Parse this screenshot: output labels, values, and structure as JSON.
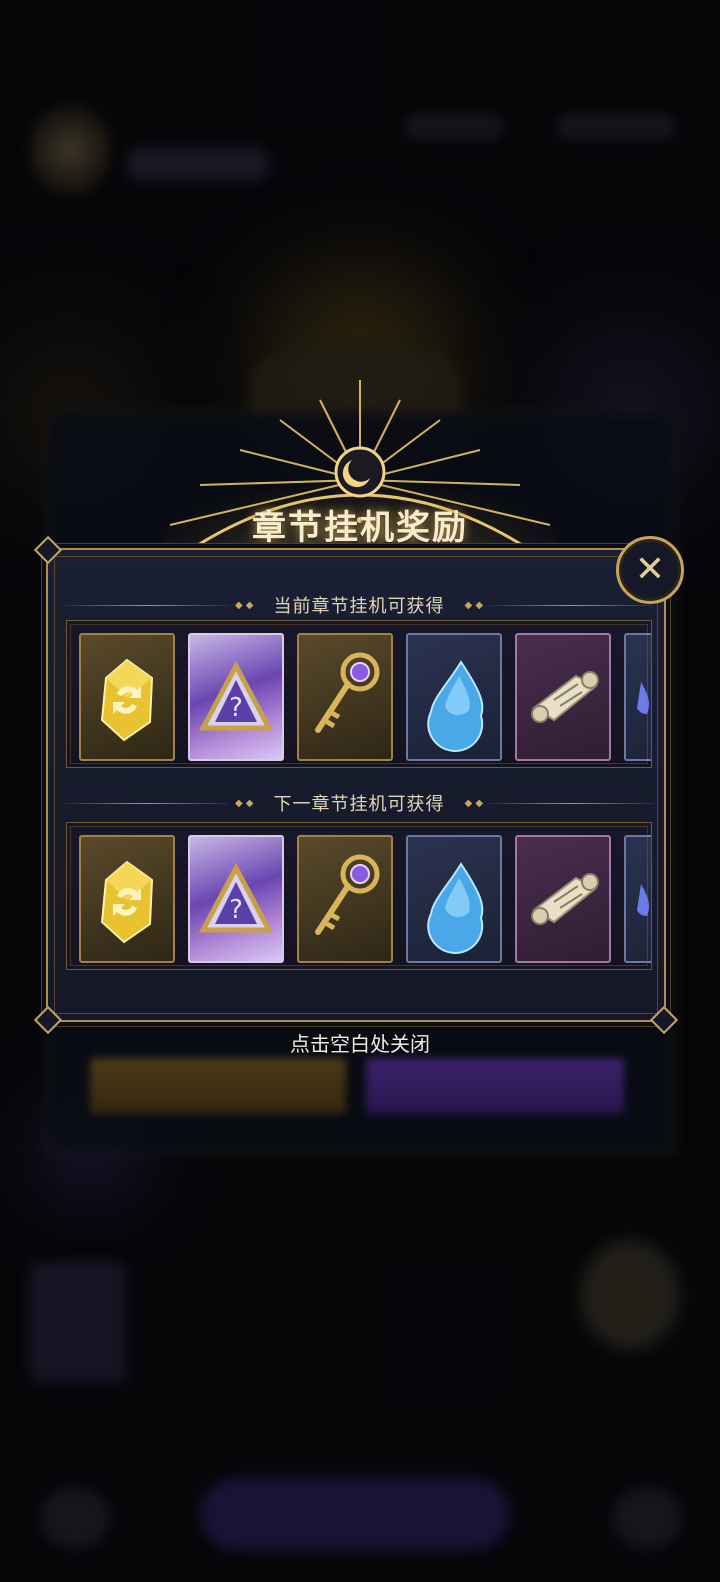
{
  "dialog": {
    "title": "章节挂机奖励",
    "close_icon": "close-x-icon",
    "sections": [
      {
        "label": "当前章节挂机可获得",
        "items": [
          {
            "icon": "yellow-crystal-refresh-icon",
            "frame": "gold"
          },
          {
            "icon": "mystery-triangle-icon",
            "frame": "rainbow"
          },
          {
            "icon": "golden-key-icon",
            "frame": "gold"
          },
          {
            "icon": "blue-gem-drop-icon",
            "frame": "blue"
          },
          {
            "icon": "scroll-icon",
            "frame": "purple"
          },
          {
            "icon": "partial-item-icon",
            "frame": "blue"
          }
        ]
      },
      {
        "label": "下一章节挂机可获得",
        "items": [
          {
            "icon": "yellow-crystal-refresh-icon",
            "frame": "gold"
          },
          {
            "icon": "mystery-triangle-icon",
            "frame": "rainbow"
          },
          {
            "icon": "golden-key-icon",
            "frame": "gold"
          },
          {
            "icon": "blue-gem-drop-icon",
            "frame": "blue"
          },
          {
            "icon": "scroll-icon",
            "frame": "purple"
          },
          {
            "icon": "partial-item-icon",
            "frame": "blue"
          }
        ]
      }
    ]
  },
  "hint": "点击空白处关闭",
  "colors": {
    "accent_gold": "#c6a460",
    "panel_bg": "#171b2d",
    "title": "#f6ecd2"
  }
}
